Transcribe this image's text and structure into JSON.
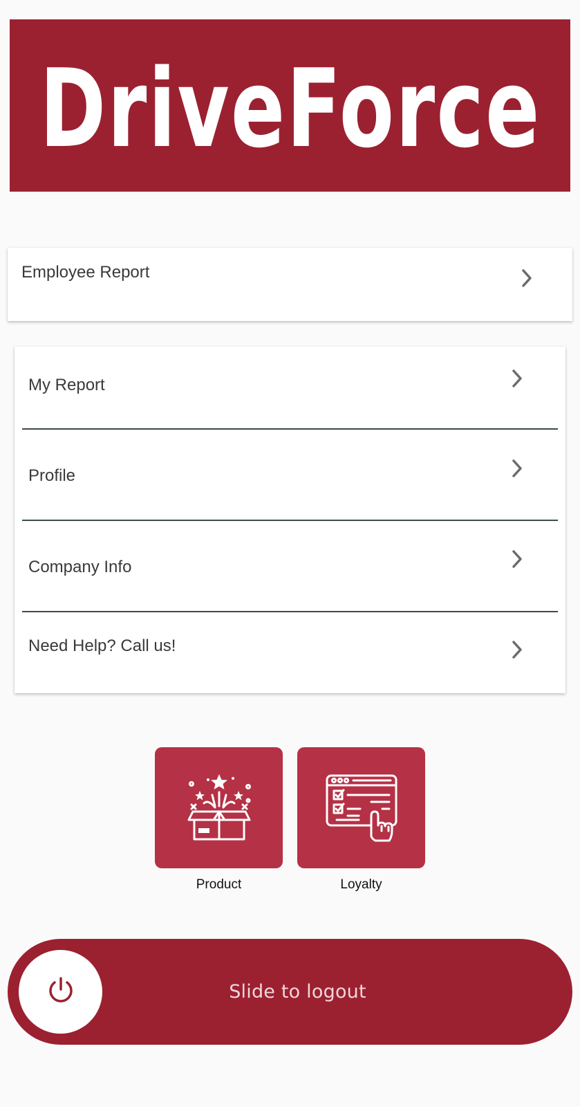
{
  "app": {
    "brand": "DriveForce",
    "brand_color": "#9b2131"
  },
  "employee_card": {
    "label": "Employee Report",
    "icon": "chevron-right-icon"
  },
  "menu": {
    "items": [
      {
        "label": "My Report",
        "icon": "chevron-right-icon"
      },
      {
        "label": "Profile",
        "icon": "chevron-right-icon"
      },
      {
        "label": "Company Info",
        "icon": "chevron-right-icon"
      },
      {
        "label": "Need Help? Call us!",
        "icon": "chevron-right-icon"
      }
    ]
  },
  "tiles": [
    {
      "label": "Product",
      "icon": "gift-box-icon",
      "color": "#b53145"
    },
    {
      "label": "Loyalty",
      "icon": "checklist-tap-icon",
      "color": "#b53145"
    }
  ],
  "logout": {
    "label": "Slide to logout",
    "icon": "power-icon"
  }
}
